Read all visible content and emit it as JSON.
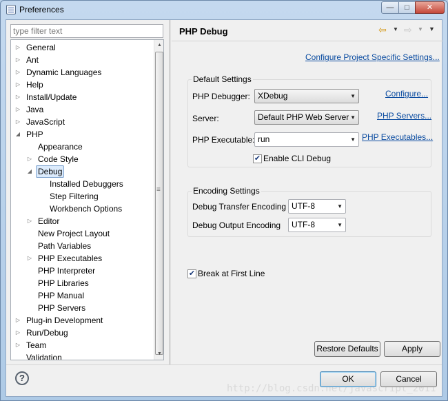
{
  "window": {
    "title": "Preferences",
    "controls": {
      "minimize": "—",
      "maximize": "□",
      "close": "✕"
    }
  },
  "filter": {
    "placeholder": "type filter text"
  },
  "tree": {
    "items": [
      {
        "label": "General",
        "level": 0,
        "state": "collapsed"
      },
      {
        "label": "Ant",
        "level": 0,
        "state": "collapsed"
      },
      {
        "label": "Dynamic Languages",
        "level": 0,
        "state": "collapsed"
      },
      {
        "label": "Help",
        "level": 0,
        "state": "collapsed"
      },
      {
        "label": "Install/Update",
        "level": 0,
        "state": "collapsed"
      },
      {
        "label": "Java",
        "level": 0,
        "state": "collapsed"
      },
      {
        "label": "JavaScript",
        "level": 0,
        "state": "collapsed"
      },
      {
        "label": "PHP",
        "level": 0,
        "state": "expanded"
      },
      {
        "label": "Appearance",
        "level": 1,
        "state": "leaf"
      },
      {
        "label": "Code Style",
        "level": 1,
        "state": "collapsed"
      },
      {
        "label": "Debug",
        "level": 1,
        "state": "expanded",
        "selected": true
      },
      {
        "label": "Installed Debuggers",
        "level": 2,
        "state": "leaf"
      },
      {
        "label": "Step Filtering",
        "level": 2,
        "state": "leaf"
      },
      {
        "label": "Workbench Options",
        "level": 2,
        "state": "leaf"
      },
      {
        "label": "Editor",
        "level": 1,
        "state": "collapsed"
      },
      {
        "label": "New Project Layout",
        "level": 1,
        "state": "leaf"
      },
      {
        "label": "Path Variables",
        "level": 1,
        "state": "leaf"
      },
      {
        "label": "PHP Executables",
        "level": 1,
        "state": "collapsed"
      },
      {
        "label": "PHP Interpreter",
        "level": 1,
        "state": "leaf"
      },
      {
        "label": "PHP Libraries",
        "level": 1,
        "state": "leaf"
      },
      {
        "label": "PHP Manual",
        "level": 1,
        "state": "leaf"
      },
      {
        "label": "PHP Servers",
        "level": 1,
        "state": "leaf"
      },
      {
        "label": "Plug-in Development",
        "level": 0,
        "state": "collapsed"
      },
      {
        "label": "Run/Debug",
        "level": 0,
        "state": "collapsed"
      },
      {
        "label": "Team",
        "level": 0,
        "state": "collapsed"
      },
      {
        "label": "Validation",
        "level": 0,
        "state": "leaf"
      }
    ]
  },
  "page": {
    "title": "PHP Debug",
    "configure_link": "Configure Project Specific Settings...",
    "default_settings": {
      "label": "Default Settings",
      "debugger_label": "PHP Debugger:",
      "debugger_value": "XDebug",
      "debugger_link": "Configure...",
      "server_label": "Server:",
      "server_value": "Default PHP Web Server",
      "server_link": "PHP Servers...",
      "executable_label": "PHP Executable:",
      "executable_value": "run",
      "executable_link": "PHP Executables...",
      "cli_debug_label": "Enable CLI Debug",
      "cli_debug_checked": true
    },
    "encoding_settings": {
      "label": "Encoding Settings",
      "transfer_label": "Debug Transfer Encoding",
      "transfer_value": "UTF-8",
      "output_label": "Debug Output Encoding",
      "output_value": "UTF-8"
    },
    "break_first_line_label": "Break at First Line",
    "break_first_line_checked": true,
    "restore_defaults": "Restore Defaults",
    "apply": "Apply"
  },
  "footer": {
    "help": "?",
    "ok": "OK",
    "cancel": "Cancel",
    "watermark": "http://blog.csdn.net/javascript_2011"
  }
}
